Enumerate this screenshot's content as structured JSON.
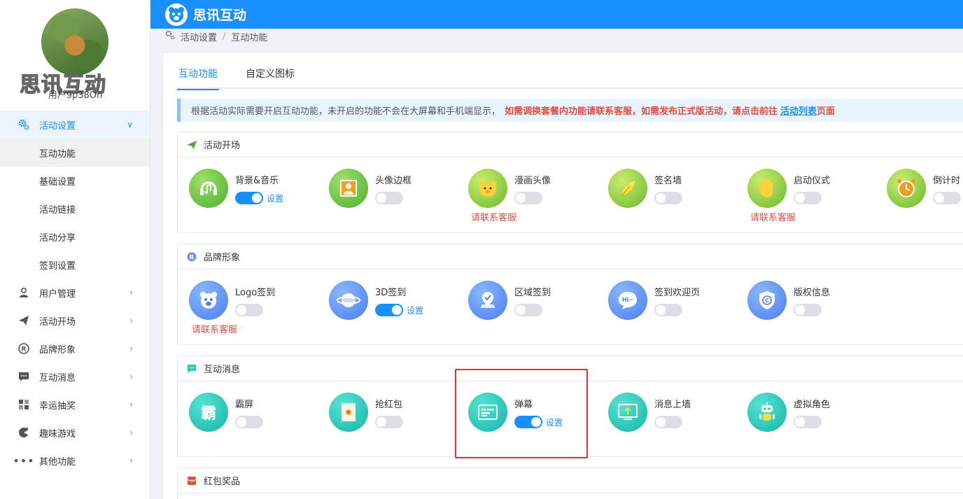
{
  "sidebar": {
    "brand_watermark": "思讯互动",
    "username": "用户9p38On",
    "menu": [
      {
        "label": "活动设置",
        "icon": "gears-icon",
        "active": true,
        "children": [
          "互动功能",
          "基础设置",
          "活动链接",
          "活动分享",
          "签到设置"
        ]
      },
      {
        "label": "用户管理",
        "icon": "user-icon"
      },
      {
        "label": "活动开场",
        "icon": "paper-plane-icon"
      },
      {
        "label": "品牌形象",
        "icon": "registered-icon"
      },
      {
        "label": "互动消息",
        "icon": "chat-bubble-icon"
      },
      {
        "label": "幸运抽奖",
        "icon": "lottery-icon"
      },
      {
        "label": "趣味游戏",
        "icon": "gamepad-icon"
      },
      {
        "label": "其他功能",
        "icon": "more-dots-icon"
      }
    ]
  },
  "header": {
    "title": "思讯互动"
  },
  "breadcrumb": [
    "活动设置",
    "互动功能"
  ],
  "tabs": [
    "互动功能",
    "自定义图标"
  ],
  "notice": {
    "text": "根据活动实际需要开启互动功能，未开启的功能不会在大屏幕和手机端显示，",
    "red": "如需调换套餐内功能请联系客服，如需发布正式版活动，请点击前往",
    "link": "活动列表",
    "suffix": "页面"
  },
  "labels": {
    "set": "设置",
    "contact": "请联系客服"
  },
  "sections": [
    {
      "title": "活动开场",
      "icon": "paper-plane-icon",
      "items": [
        {
          "name": "背景&音乐",
          "icon": "music-icon",
          "on": true
        },
        {
          "name": "头像边框",
          "icon": "avatar-frame-icon",
          "on": false
        },
        {
          "name": "漫画头像",
          "icon": "cartoon-face-icon",
          "on": false,
          "contact": true
        },
        {
          "name": "签名墙",
          "icon": "feather-pen-icon",
          "on": false
        },
        {
          "name": "启动仪式",
          "icon": "hand-icon",
          "on": false,
          "contact": true
        },
        {
          "name": "倒计时",
          "icon": "alarm-clock-icon",
          "on": false
        }
      ]
    },
    {
      "title": "品牌形象",
      "icon": "registered-icon",
      "items": [
        {
          "name": "Logo签到",
          "icon": "bear-logo-icon",
          "on": false,
          "contact": true
        },
        {
          "name": "3D签到",
          "icon": "planet-icon",
          "on": true
        },
        {
          "name": "区域签到",
          "icon": "location-check-icon",
          "on": false
        },
        {
          "name": "签到欢迎页",
          "icon": "hi-bubble-icon",
          "on": false
        },
        {
          "name": "版权信息",
          "icon": "copyright-shield-icon",
          "on": false
        }
      ]
    },
    {
      "title": "互动消息",
      "icon": "chat-bubble-icon",
      "items": [
        {
          "name": "霸屏",
          "icon": "ba-character-icon",
          "on": false
        },
        {
          "name": "抢红包",
          "icon": "red-envelope-icon",
          "on": false
        },
        {
          "name": "弹幕",
          "icon": "danmaku-screen-icon",
          "on": true
        },
        {
          "name": "消息上墙",
          "icon": "monitor-upload-icon",
          "on": false
        },
        {
          "name": "虚拟角色",
          "icon": "robot-icon",
          "on": false
        }
      ]
    },
    {
      "title": "红包奖品",
      "icon": "red-gift-icon",
      "items": []
    }
  ],
  "colors": {
    "primary": "#1890ff",
    "danger": "#e74c3c",
    "green": "#4cae2e",
    "blue": "#4a7ef0",
    "teal": "#18b5a8"
  }
}
